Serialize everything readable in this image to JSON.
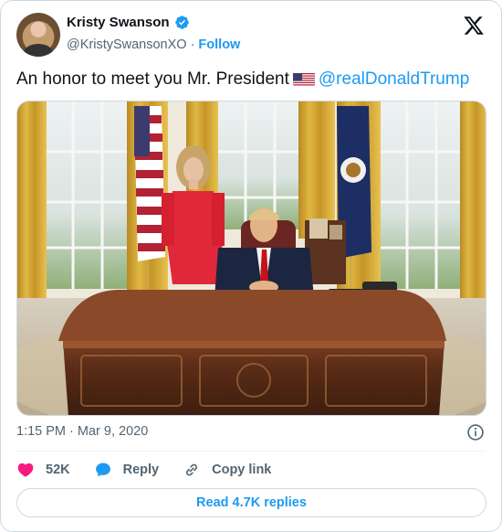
{
  "author": {
    "name": "Kristy Swanson",
    "handle": "@KristySwansonXO",
    "separator": "·",
    "follow_label": "Follow"
  },
  "tweet": {
    "text_before": "An honor to meet you Mr. President",
    "flag_icon": "us-flag-emoji",
    "mention": "@realDonaldTrump",
    "timestamp": "1:15 PM · Mar 9, 2020"
  },
  "actions": {
    "likes": "52K",
    "reply_label": "Reply",
    "copy_link_label": "Copy link"
  },
  "read_replies_label": "Read 4.7K replies",
  "colors": {
    "accent": "#1d9bf0",
    "like": "#f91880",
    "text": "#0f1419",
    "secondary": "#536471"
  }
}
